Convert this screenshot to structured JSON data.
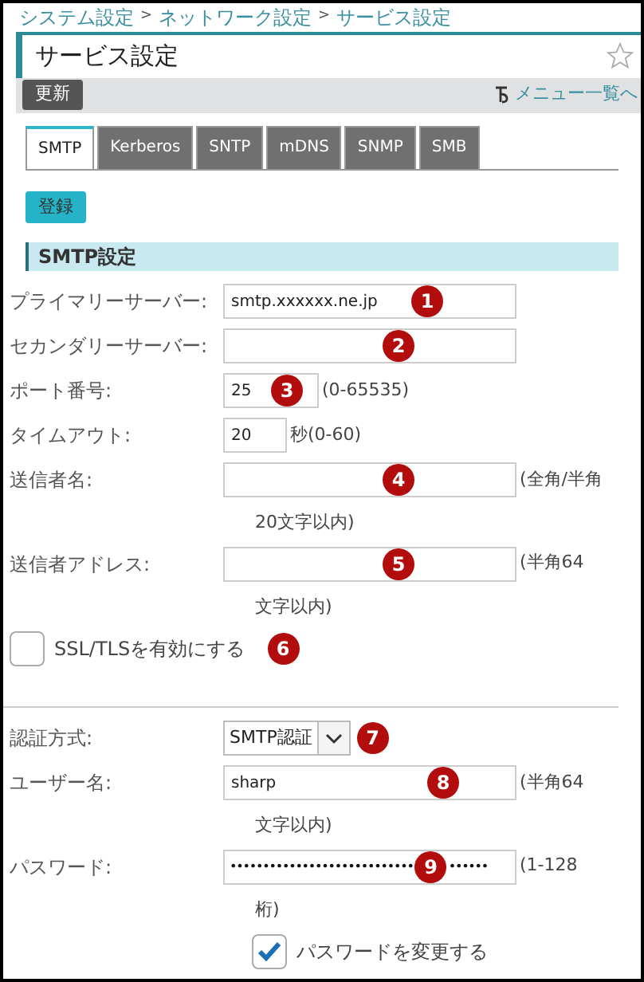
{
  "breadcrumb": [
    "システム設定",
    "ネットワーク設定",
    "サービス設定"
  ],
  "breadcrumb_separator": ">",
  "title": "サービス設定",
  "toolbar": {
    "refresh": "更新",
    "menu_link": "メニュー一覧へ"
  },
  "tabs": [
    {
      "label": "SMTP",
      "selected": true
    },
    {
      "label": "Kerberos",
      "selected": false
    },
    {
      "label": "SNTP",
      "selected": false
    },
    {
      "label": "mDNS",
      "selected": false
    },
    {
      "label": "SNMP",
      "selected": false
    },
    {
      "label": "SMB",
      "selected": false
    }
  ],
  "register_button": "登録",
  "section_title": "SMTP設定",
  "fields": [
    {
      "kind": "text",
      "label": "プライマリーサーバー:",
      "value": "smtp.xxxxxx.ne.jp",
      "marker": "1"
    },
    {
      "kind": "text",
      "label": "セカンダリーサーバー:",
      "marker": "2"
    },
    {
      "kind": "port",
      "label": "ポート番号:",
      "value": "25",
      "note": "(0-65535)",
      "marker": "3"
    },
    {
      "kind": "short",
      "label": "タイムアウト:",
      "value": "20",
      "note": "秒(0-60)"
    },
    {
      "kind": "text",
      "label": "送信者名:",
      "note": "(全角/半角",
      "note_cont": "20文字以内)",
      "marker": "4"
    },
    {
      "kind": "text",
      "label": "送信者アドレス:",
      "note": "(半角64",
      "note_cont": "文字以内)",
      "marker": "5"
    },
    {
      "kind": "checkbox",
      "label": "SSL/TLSを有効にする",
      "checked": false,
      "marker": "6"
    },
    {
      "kind": "divider"
    },
    {
      "kind": "select",
      "label": "認証方式:",
      "value": "SMTP認証",
      "marker": "7"
    },
    {
      "kind": "text",
      "label": "ユーザー名:",
      "value": "sharp",
      "note": "(半角64",
      "note_cont": "文字以内)",
      "marker": "8"
    },
    {
      "label": "パスワード:",
      "kind": "password",
      "value_parts": [
        "••••••••••••••••••••••••••••",
        "••••••"
      ],
      "note": "(1-128",
      "note_cont": "桁)",
      "marker": "9"
    },
    {
      "kind": "checkbox_indent",
      "label": "パスワードを変更する",
      "checked": true
    }
  ]
}
